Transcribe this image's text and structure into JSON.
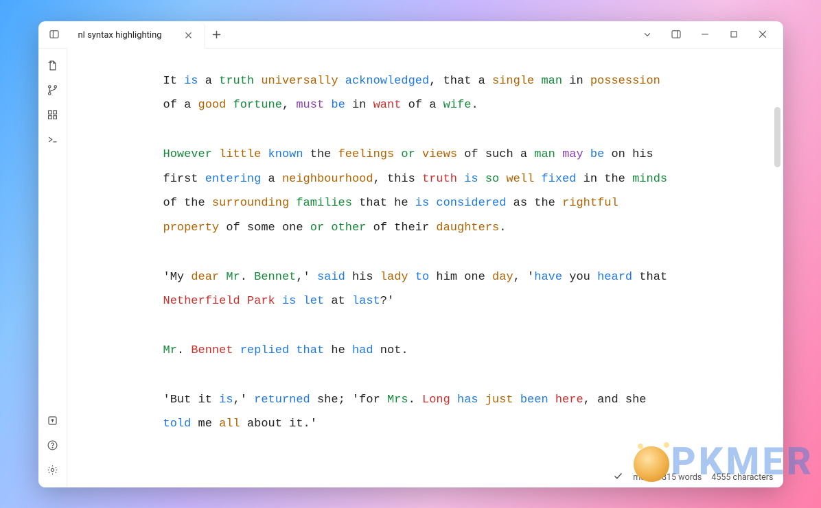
{
  "tab": {
    "title": "nl syntax highlighting"
  },
  "status": {
    "branch": "main",
    "words": "815 words",
    "chars": "4555 characters"
  },
  "watermark": "PKMER",
  "colors": {
    "default": "#222222",
    "blue": "#1f7ae0",
    "green": "#158a3a",
    "brown": "#b06400",
    "purple": "#8b3fad",
    "red": "#c9302c"
  },
  "text": [
    [
      {
        "t": "It ",
        "c": "default"
      },
      {
        "t": "is",
        "c": "blue"
      },
      {
        "t": " a ",
        "c": "default"
      },
      {
        "t": "truth",
        "c": "green"
      },
      {
        "t": " ",
        "c": "default"
      },
      {
        "t": "universally",
        "c": "brown"
      },
      {
        "t": " ",
        "c": "default"
      },
      {
        "t": "acknowledged",
        "c": "blue"
      },
      {
        "t": ", that a ",
        "c": "default"
      },
      {
        "t": "single",
        "c": "brown"
      },
      {
        "t": " ",
        "c": "default"
      },
      {
        "t": "man",
        "c": "green"
      },
      {
        "t": " in ",
        "c": "default"
      },
      {
        "t": "possession",
        "c": "brown"
      },
      {
        "t": " of a ",
        "c": "default"
      },
      {
        "t": "good",
        "c": "brown"
      },
      {
        "t": " ",
        "c": "default"
      },
      {
        "t": "fortune",
        "c": "green"
      },
      {
        "t": ", ",
        "c": "default"
      },
      {
        "t": "must",
        "c": "purple"
      },
      {
        "t": " ",
        "c": "default"
      },
      {
        "t": "be",
        "c": "blue"
      },
      {
        "t": " in ",
        "c": "default"
      },
      {
        "t": "want",
        "c": "red"
      },
      {
        "t": " of a ",
        "c": "default"
      },
      {
        "t": "wife",
        "c": "green"
      },
      {
        "t": ".",
        "c": "default"
      }
    ],
    [
      {
        "t": "However",
        "c": "green"
      },
      {
        "t": " ",
        "c": "default"
      },
      {
        "t": "little",
        "c": "brown"
      },
      {
        "t": " ",
        "c": "default"
      },
      {
        "t": "known",
        "c": "blue"
      },
      {
        "t": " the ",
        "c": "default"
      },
      {
        "t": "feelings",
        "c": "brown"
      },
      {
        "t": " ",
        "c": "default"
      },
      {
        "t": "or",
        "c": "green"
      },
      {
        "t": " ",
        "c": "default"
      },
      {
        "t": "views",
        "c": "brown"
      },
      {
        "t": " of such a ",
        "c": "default"
      },
      {
        "t": "man",
        "c": "green"
      },
      {
        "t": " ",
        "c": "default"
      },
      {
        "t": "may",
        "c": "purple"
      },
      {
        "t": " ",
        "c": "default"
      },
      {
        "t": "be",
        "c": "blue"
      },
      {
        "t": " on his first ",
        "c": "default"
      },
      {
        "t": "entering",
        "c": "blue"
      },
      {
        "t": " a ",
        "c": "default"
      },
      {
        "t": "neighbourhood",
        "c": "brown"
      },
      {
        "t": ", this ",
        "c": "default"
      },
      {
        "t": "truth",
        "c": "red"
      },
      {
        "t": " ",
        "c": "default"
      },
      {
        "t": "is",
        "c": "blue"
      },
      {
        "t": " ",
        "c": "default"
      },
      {
        "t": "so",
        "c": "green"
      },
      {
        "t": " ",
        "c": "default"
      },
      {
        "t": "well",
        "c": "brown"
      },
      {
        "t": " ",
        "c": "default"
      },
      {
        "t": "fixed",
        "c": "blue"
      },
      {
        "t": " in the ",
        "c": "default"
      },
      {
        "t": "minds",
        "c": "green"
      },
      {
        "t": " of the ",
        "c": "default"
      },
      {
        "t": "surrounding",
        "c": "brown"
      },
      {
        "t": " ",
        "c": "default"
      },
      {
        "t": "families",
        "c": "green"
      },
      {
        "t": " that he ",
        "c": "default"
      },
      {
        "t": "is",
        "c": "blue"
      },
      {
        "t": " ",
        "c": "default"
      },
      {
        "t": "considered",
        "c": "blue"
      },
      {
        "t": " as the ",
        "c": "default"
      },
      {
        "t": "rightful",
        "c": "brown"
      },
      {
        "t": " ",
        "c": "default"
      },
      {
        "t": "property",
        "c": "brown"
      },
      {
        "t": " of some one ",
        "c": "default"
      },
      {
        "t": "or",
        "c": "green"
      },
      {
        "t": " ",
        "c": "default"
      },
      {
        "t": "other",
        "c": "green"
      },
      {
        "t": " of their ",
        "c": "default"
      },
      {
        "t": "daughters",
        "c": "brown"
      },
      {
        "t": ".",
        "c": "default"
      }
    ],
    [
      {
        "t": "'My ",
        "c": "default"
      },
      {
        "t": "dear",
        "c": "brown"
      },
      {
        "t": " ",
        "c": "default"
      },
      {
        "t": "Mr",
        "c": "green"
      },
      {
        "t": ". ",
        "c": "default"
      },
      {
        "t": "Bennet",
        "c": "green"
      },
      {
        "t": ",' ",
        "c": "default"
      },
      {
        "t": "said",
        "c": "blue"
      },
      {
        "t": " his ",
        "c": "default"
      },
      {
        "t": "lady",
        "c": "brown"
      },
      {
        "t": " ",
        "c": "default"
      },
      {
        "t": "to",
        "c": "blue"
      },
      {
        "t": " him one ",
        "c": "default"
      },
      {
        "t": "day",
        "c": "brown"
      },
      {
        "t": ", '",
        "c": "default"
      },
      {
        "t": "have",
        "c": "blue"
      },
      {
        "t": " you ",
        "c": "default"
      },
      {
        "t": "heard",
        "c": "blue"
      },
      {
        "t": " that ",
        "c": "default"
      },
      {
        "t": "Netherfield",
        "c": "red"
      },
      {
        "t": " ",
        "c": "default"
      },
      {
        "t": "Park",
        "c": "red"
      },
      {
        "t": " ",
        "c": "default"
      },
      {
        "t": "is",
        "c": "blue"
      },
      {
        "t": " ",
        "c": "default"
      },
      {
        "t": "let",
        "c": "blue"
      },
      {
        "t": " at ",
        "c": "default"
      },
      {
        "t": "last",
        "c": "blue"
      },
      {
        "t": "?'",
        "c": "default"
      }
    ],
    [
      {
        "t": "Mr",
        "c": "green"
      },
      {
        "t": ". ",
        "c": "default"
      },
      {
        "t": "Bennet",
        "c": "red"
      },
      {
        "t": " ",
        "c": "default"
      },
      {
        "t": "replied",
        "c": "blue"
      },
      {
        "t": " ",
        "c": "default"
      },
      {
        "t": "that",
        "c": "blue"
      },
      {
        "t": " he ",
        "c": "default"
      },
      {
        "t": "had",
        "c": "blue"
      },
      {
        "t": " not.",
        "c": "default"
      }
    ],
    [
      {
        "t": "'But it ",
        "c": "default"
      },
      {
        "t": "is",
        "c": "blue"
      },
      {
        "t": ",' ",
        "c": "default"
      },
      {
        "t": "returned",
        "c": "blue"
      },
      {
        "t": " she; 'for ",
        "c": "default"
      },
      {
        "t": "Mrs",
        "c": "green"
      },
      {
        "t": ". ",
        "c": "default"
      },
      {
        "t": "Long",
        "c": "red"
      },
      {
        "t": " ",
        "c": "default"
      },
      {
        "t": "has",
        "c": "blue"
      },
      {
        "t": " ",
        "c": "default"
      },
      {
        "t": "just",
        "c": "brown"
      },
      {
        "t": " ",
        "c": "default"
      },
      {
        "t": "been",
        "c": "blue"
      },
      {
        "t": " ",
        "c": "default"
      },
      {
        "t": "here",
        "c": "red"
      },
      {
        "t": ", and she ",
        "c": "default"
      },
      {
        "t": "told",
        "c": "blue"
      },
      {
        "t": " me ",
        "c": "default"
      },
      {
        "t": "all",
        "c": "brown"
      },
      {
        "t": " about it.'",
        "c": "default"
      }
    ]
  ]
}
